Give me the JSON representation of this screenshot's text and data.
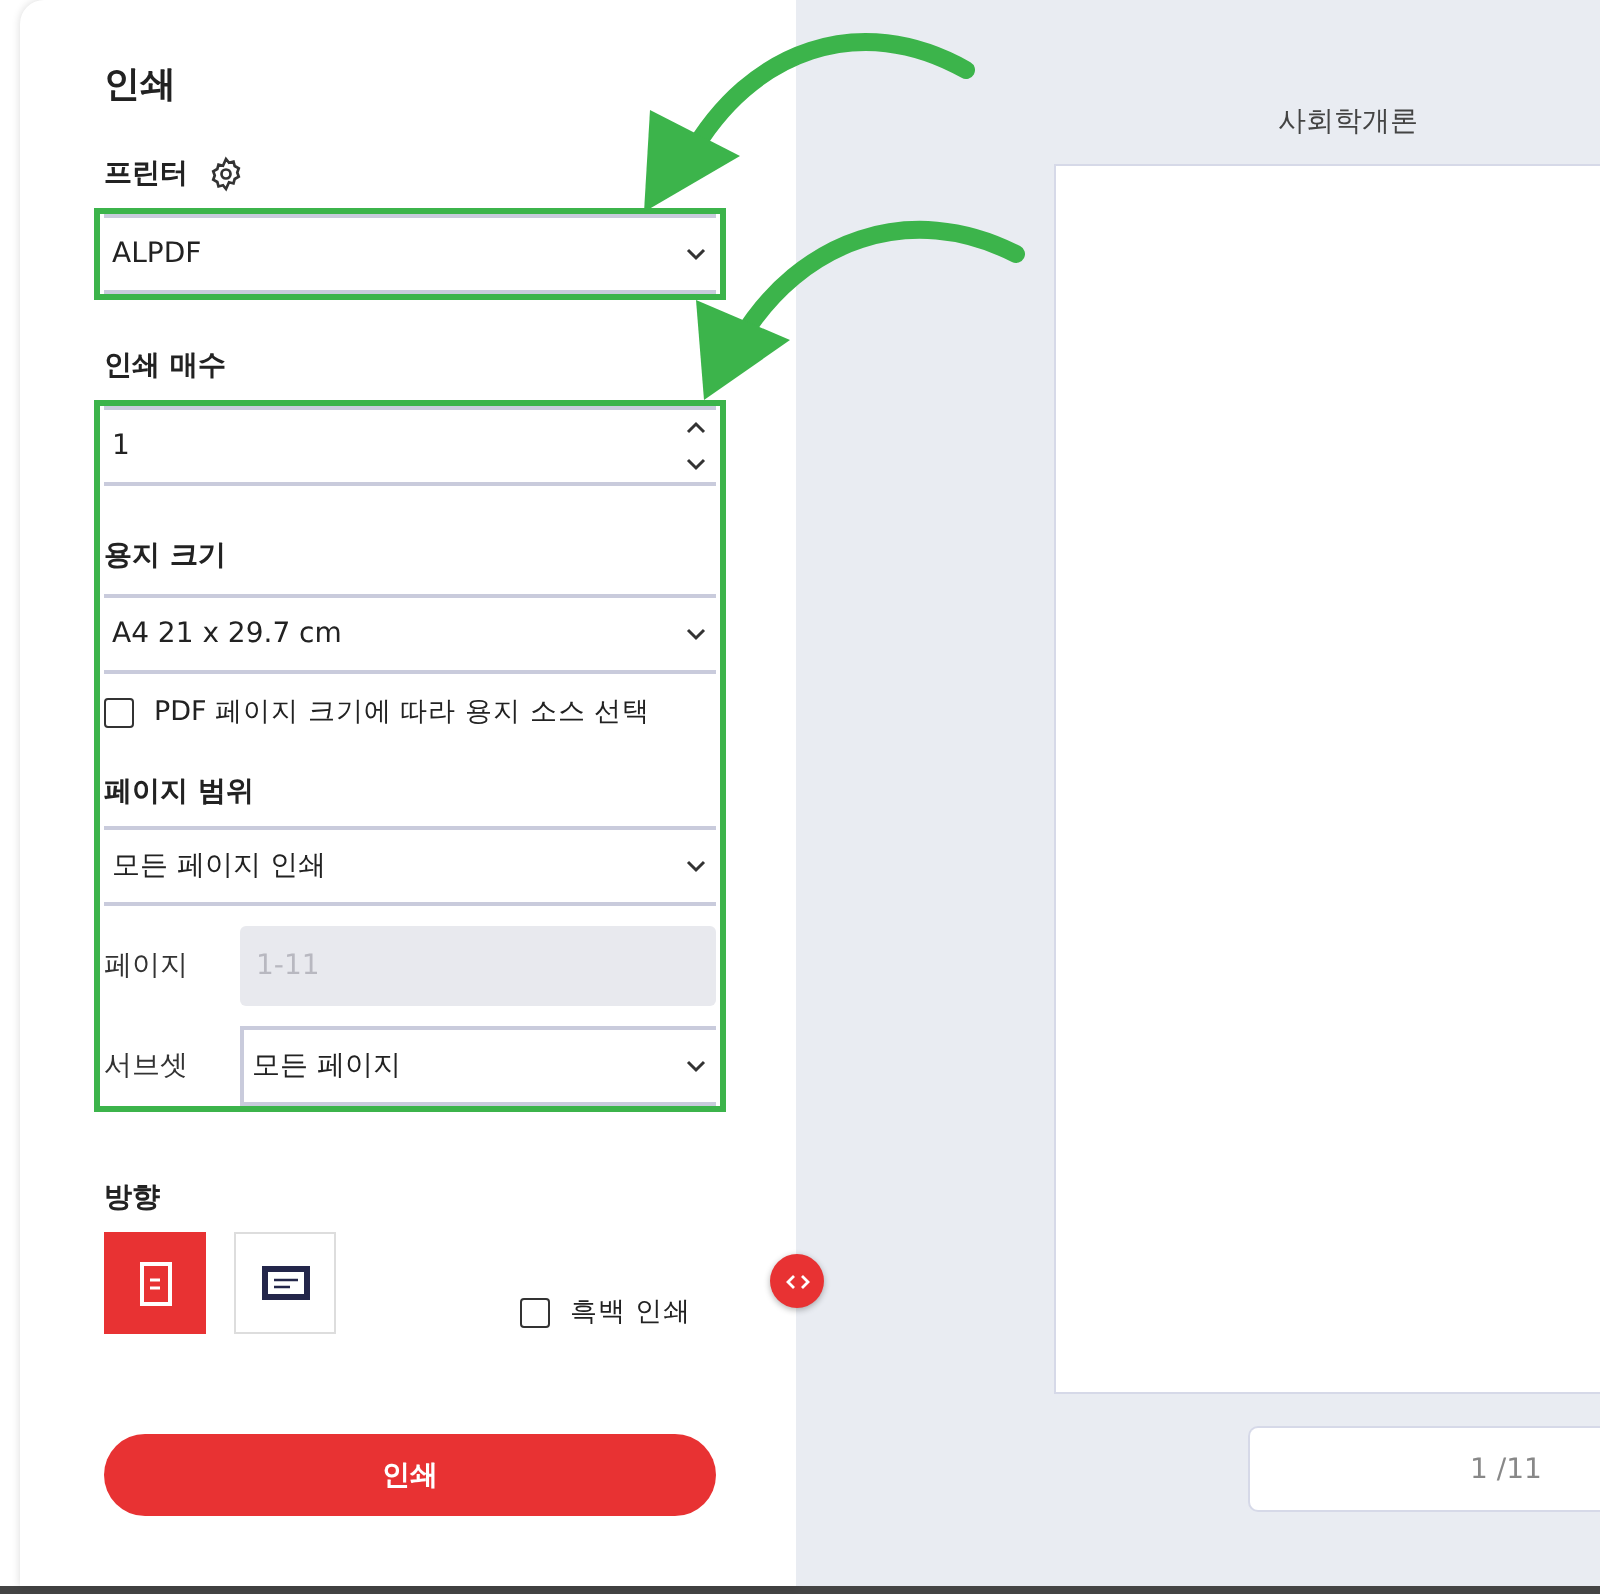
{
  "panel": {
    "title": "인쇄"
  },
  "printer": {
    "label": "프린터",
    "value": "ALPDF"
  },
  "copies": {
    "label": "인쇄 매수",
    "value": "1"
  },
  "paper_size": {
    "label": "용지 크기",
    "value": "A4 21 x 29.7 cm"
  },
  "pdf_page_size_source": {
    "label": "PDF 페이지 크기에 따라 용지 소스 선택",
    "checked": false
  },
  "page_range": {
    "label": "페이지 범위",
    "value": "모든 페이지 인쇄",
    "pages_label": "페이지",
    "pages_value": "1-11",
    "pages_disabled": true,
    "subset_label": "서브셋",
    "subset_value": "모든 페이지"
  },
  "orientation": {
    "label": "방향",
    "options": [
      {
        "kind": "portrait",
        "selected": true
      },
      {
        "kind": "landscape",
        "selected": false
      }
    ]
  },
  "grayscale": {
    "label": "흑백 인쇄",
    "checked": false
  },
  "print_button": "인쇄",
  "preview": {
    "title": "사회학개론",
    "page_indicator": "1 /11"
  },
  "annotation": {
    "color": "#3cb44b"
  }
}
